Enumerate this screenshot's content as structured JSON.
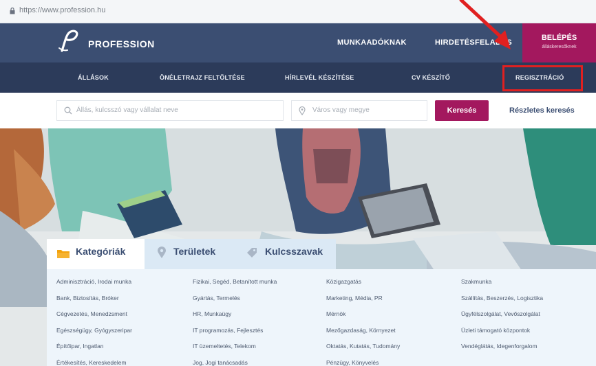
{
  "browser": {
    "url": "https://www.profession.hu"
  },
  "header": {
    "logo_text": "PROFESSION",
    "links": [
      "MUNKAADÓKNAK",
      "HIRDETÉSFELADÁS"
    ],
    "login_label": "BELÉPÉS",
    "login_sub": "álláskeresőknek"
  },
  "subnav": {
    "items": [
      "ÁLLÁSOK",
      "ÖNÉLETRAJZ FELTÖLTÉSE",
      "HÍRLEVÉL KÉSZÍTÉSE",
      "CV KÉSZÍTŐ",
      "REGISZTRÁCIÓ"
    ]
  },
  "search": {
    "keyword_placeholder": "Állás, kulcsszó vagy vállalat neve",
    "location_placeholder": "Város vagy megye",
    "button_label": "Keresés",
    "advanced_label": "Részletes keresés"
  },
  "tabs": [
    "Kategóriák",
    "Területek",
    "Kulcsszavak"
  ],
  "categories": {
    "col1": [
      "Adminisztráció, Irodai munka",
      "Bank, Biztosítás, Bróker",
      "Cégvezetés, Menedzsment",
      "Egészségügy, Gyógyszeripar",
      "Építőipar, Ingatlan",
      "Értékesítés, Kereskedelem"
    ],
    "col2": [
      "Fizikai, Segéd, Betanított munka",
      "Gyártás, Termelés",
      "HR, Munkaügy",
      "IT programozás, Fejlesztés",
      "IT üzemeltetés, Telekom",
      "Jog, Jogi tanácsadás"
    ],
    "col3": [
      "Közigazgatás",
      "Marketing, Média, PR",
      "Mérnök",
      "Mezőgazdaság, Környezet",
      "Oktatás, Kutatás, Tudomány",
      "Pénzügy, Könyvelés"
    ],
    "col4": [
      "Szakmunka",
      "Szállítás, Beszerzés, Logisztika",
      "Ügyfélszolgálat, Vevőszolgálat",
      "Üzleti támogató központok",
      "Vendéglátás, Idegenforgalom"
    ]
  },
  "colors": {
    "nav": "#3b4e72",
    "subnav": "#2c3b5a",
    "accent": "#a3185e",
    "highlight": "#e02020"
  }
}
